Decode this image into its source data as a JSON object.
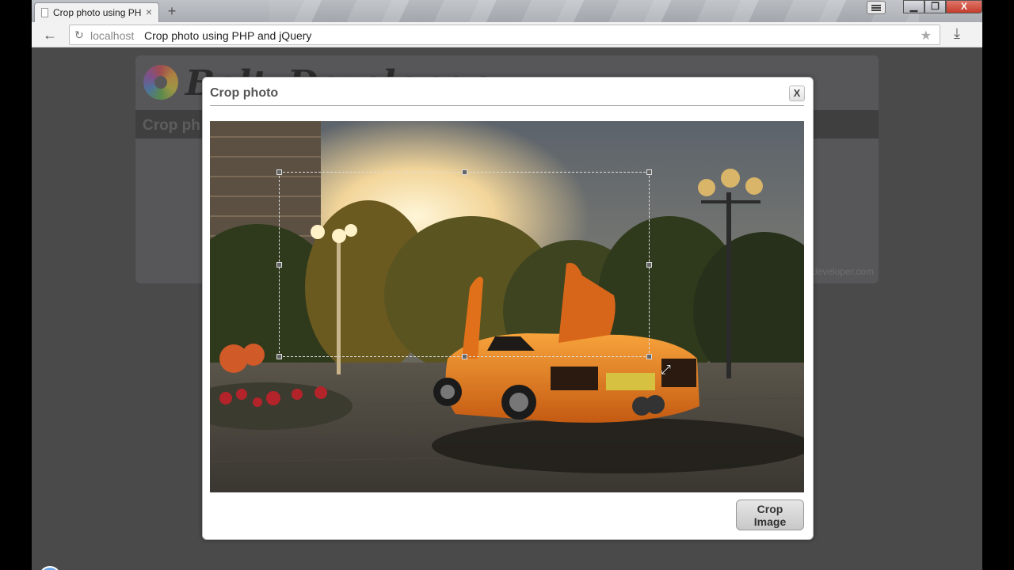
{
  "browser": {
    "tab_title": "Crop photo using PHP",
    "tab_close": "×",
    "new_tab": "+",
    "url_host": "localhost",
    "url_path": "Crop photo using PHP and jQuery",
    "window_controls": {
      "minimize": "▁",
      "maximize": "❐",
      "close": "X"
    }
  },
  "page": {
    "logo_text": "BoltyDeveloper",
    "heading": "Crop ph",
    "footer_credit": "developer.com"
  },
  "modal": {
    "title": "Crop photo",
    "close_label": "X",
    "crop_button": "Crop Image"
  },
  "icons": [
    "page-icon",
    "back-arrow-icon",
    "reload-icon",
    "star-icon",
    "download-icon",
    "menu-icon",
    "resize-cursor-icon"
  ],
  "colors": {
    "overlay": "#4a4a4b",
    "close_button": "#c43c2c"
  }
}
